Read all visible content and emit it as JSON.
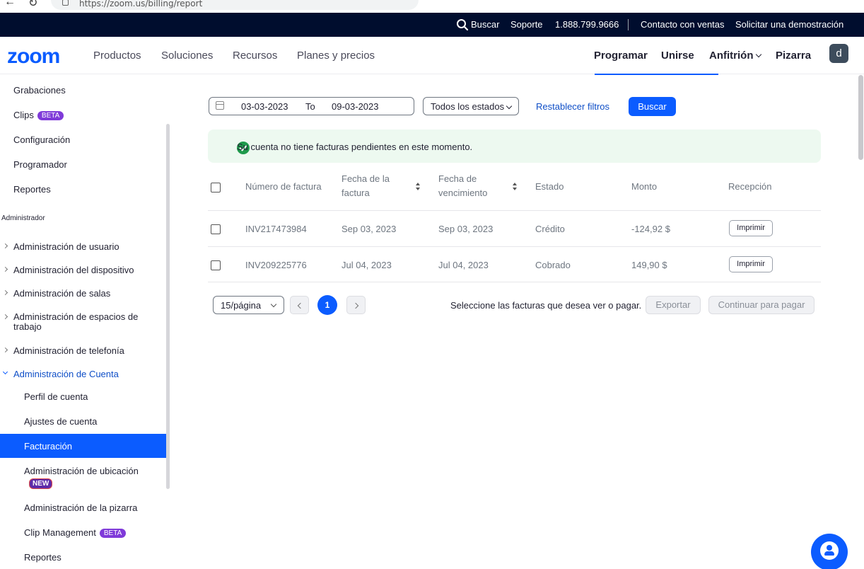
{
  "browser": {
    "url": "https://zoom.us/billing/report"
  },
  "topbar": {
    "search": "Buscar",
    "support": "Soporte",
    "phone": "1.888.799.9666",
    "contact_sales": "Contacto con ventas",
    "demo": "Solicitar una demostración"
  },
  "nav": {
    "logo": "zoom",
    "items": [
      "Productos",
      "Soluciones",
      "Recursos",
      "Planes y precios"
    ],
    "schedule": "Programar",
    "join": "Unirse",
    "host": "Anfitrión",
    "whiteboard": "Pizarra",
    "avatar": "d"
  },
  "sidebar": {
    "recordings": "Grabaciones",
    "clips": "Clips",
    "beta": "BETA",
    "settings": "Configuración",
    "scheduler": "Programador",
    "reports": "Reportes",
    "admin_section": "Administrador",
    "user_mgmt": "Administración de usuario",
    "device_mgmt": "Administración del dispositivo",
    "room_mgmt": "Administración de salas",
    "workspace_mgmt": "Administración de espacios de trabajo",
    "phone_mgmt": "Administración de telefonía",
    "account_mgmt": "Administración de Cuenta",
    "account_profile": "Perfil de cuenta",
    "account_settings": "Ajustes de cuenta",
    "billing": "Facturación",
    "location_mgmt": "Administración de ubicación",
    "new": "NEW",
    "whiteboard_mgmt": "Administración de la pizarra",
    "clip_mgmt": "Clip Management",
    "sub_reports": "Reportes"
  },
  "filters": {
    "date_from": "03-03-2023",
    "to": "To",
    "date_to": "09-03-2023",
    "status": "Todos los estados",
    "reset": "Restablecer filtros",
    "search": "Buscar"
  },
  "alert": {
    "message": "Su cuenta no tiene facturas pendientes en este momento."
  },
  "table": {
    "headers": {
      "invoice_no": "Número de factura",
      "invoice_date_1": "Fecha de la",
      "invoice_date_2": "factura",
      "due_date_1": "Fecha de",
      "due_date_2": "vencimiento",
      "status": "Estado",
      "amount": "Monto",
      "receipt": "Recepción"
    },
    "rows": [
      {
        "invoice": "INV217473984",
        "date": "Sep 03, 2023",
        "due": "Sep 03, 2023",
        "status": "Crédito",
        "amount": "-124,92 $",
        "action": "Imprimir"
      },
      {
        "invoice": "INV209225776",
        "date": "Jul 04, 2023",
        "due": "Jul 04, 2023",
        "status": "Cobrado",
        "amount": "149,90 $",
        "action": "Imprimir"
      }
    ]
  },
  "pagination": {
    "page_size": "15/página",
    "current": "1",
    "hint": "Seleccione las facturas que desea ver o pagar.",
    "export": "Exportar",
    "continue": "Continuar para pagar"
  }
}
